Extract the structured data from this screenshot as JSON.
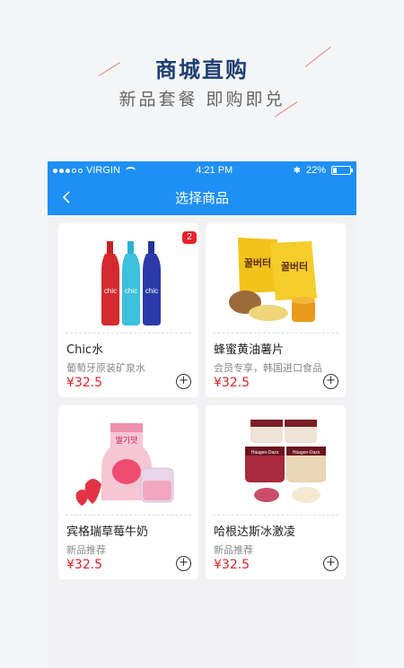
{
  "promo": {
    "title": "商城直购",
    "subtitle": "新品套餐  即购即兑"
  },
  "statusbar": {
    "carrier": "VIRGIN",
    "time": "4:21 PM",
    "battery": "22%"
  },
  "navbar": {
    "title": "选择商品",
    "back_icon": "chevron-left-icon"
  },
  "products": [
    {
      "name": "Chic水",
      "desc": "葡萄牙原装矿泉水",
      "price": "¥32.5",
      "badge": "2",
      "add_label": "+"
    },
    {
      "name": "蜂蜜黄油薯片",
      "desc": "会员专享，韩国进口食品",
      "price": "¥32.5",
      "add_label": "+"
    },
    {
      "name": "宾格瑞草莓牛奶",
      "desc": "新品推荐",
      "price": "¥32.5",
      "add_label": "+"
    },
    {
      "name": "哈根达斯冰激凌",
      "desc": "新品推荐",
      "price": "¥32.5",
      "add_label": "+"
    }
  ],
  "images": {
    "bottle_label": "chic",
    "chips_label": "꿀버터",
    "milk_label": "딸기맛",
    "icecream_label": "Häagen-Dazs"
  },
  "colors": {
    "accent": "#1e8ff5",
    "price": "#e0242c",
    "title": "#1f3f73"
  }
}
